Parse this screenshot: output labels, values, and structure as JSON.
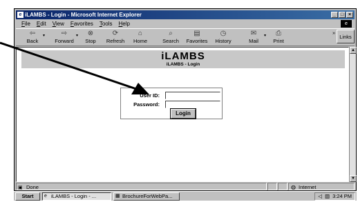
{
  "window": {
    "title": "iLAMBS - Login - Microsoft Internet Explorer",
    "controls": [
      "_",
      "□",
      "×"
    ]
  },
  "menu": [
    "File",
    "Edit",
    "View",
    "Favorites",
    "Tools",
    "Help"
  ],
  "toolbar": {
    "back": "Back",
    "forward": "Forward",
    "stop": "Stop",
    "refresh": "Refresh",
    "home": "Home",
    "search": "Search",
    "favorites": "Favorites",
    "history": "History",
    "mail": "Mail",
    "print": "Print",
    "links": "Links",
    "chevron": "»"
  },
  "page": {
    "app_title": "iLAMBS",
    "subtitle": "iLAMBS - Login",
    "userid_label": "User ID:",
    "password_label": "Password:",
    "userid_value": "",
    "password_value": "",
    "login_button": "Login"
  },
  "status": {
    "text": "Done",
    "zone": "Internet"
  },
  "taskbar": {
    "start": "Start",
    "tasks": [
      "iLAMBS - Login - ...",
      "BrochureForWebPa..."
    ],
    "clock": "3:24 PM"
  },
  "icons": {
    "back": "back-arrow-icon",
    "forward": "forward-arrow-icon",
    "stop": "stop-icon",
    "refresh": "refresh-icon",
    "home": "home-icon",
    "search": "search-icon",
    "favorites": "favorites-icon",
    "history": "history-icon",
    "mail": "mail-icon",
    "print": "print-icon"
  }
}
